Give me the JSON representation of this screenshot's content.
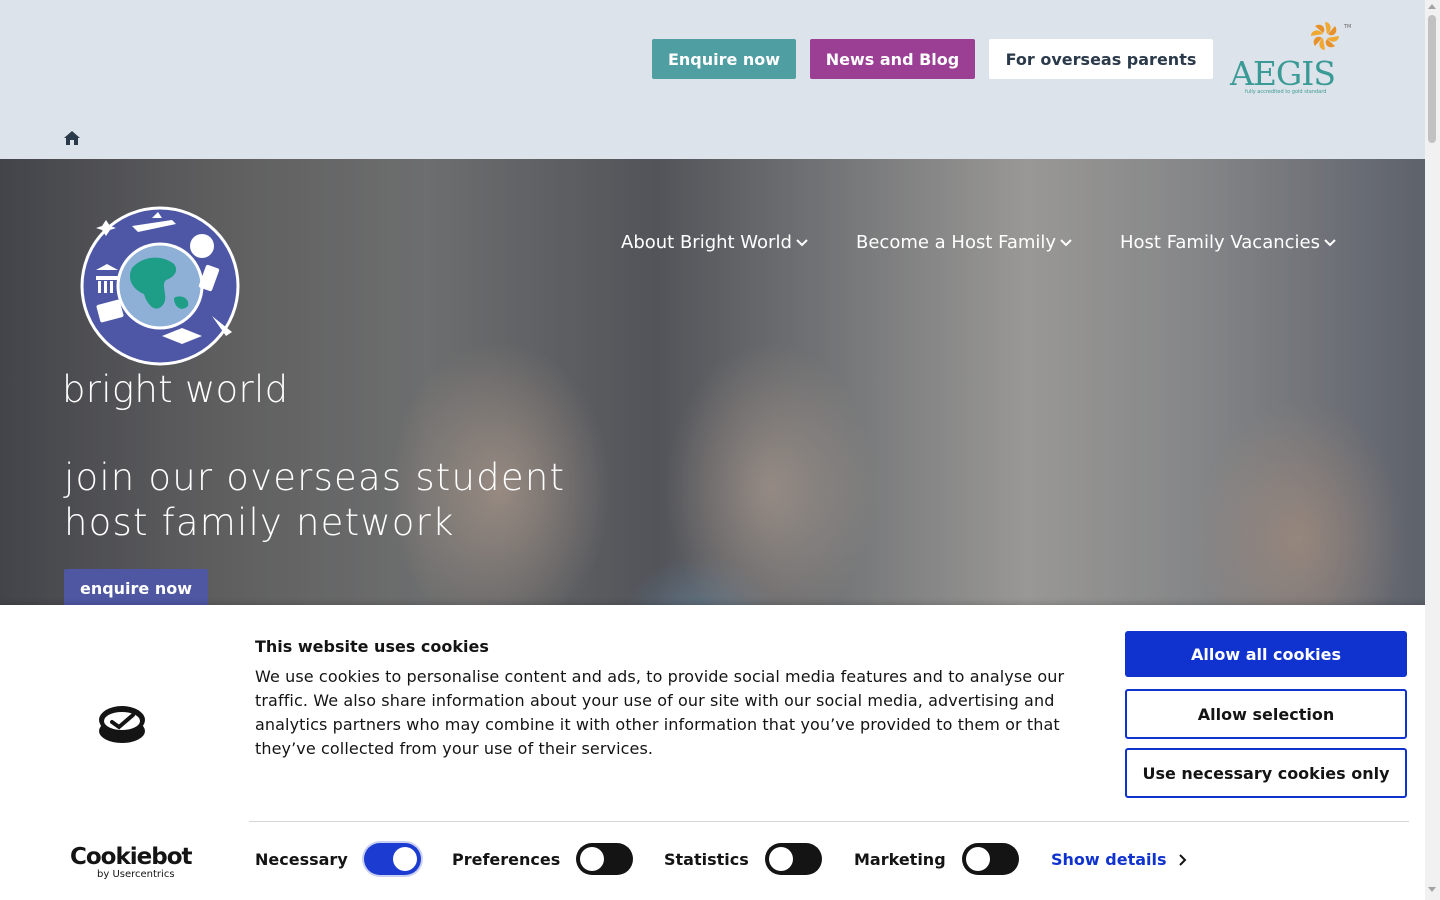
{
  "header": {
    "buttons": [
      {
        "label": "Enquire now"
      },
      {
        "label": "News and Blog"
      },
      {
        "label": "For overseas parents"
      }
    ],
    "accreditation_logo": {
      "name": "AEGIS",
      "tagline": "fully accredited to gold standard"
    },
    "home_icon": "home-icon"
  },
  "hero": {
    "logo_text": "bright world",
    "nav": [
      {
        "label": "About Bright World"
      },
      {
        "label": "Become a Host Family"
      },
      {
        "label": "Host Family Vacancies"
      }
    ],
    "headline_line1": "join our overseas student",
    "headline_line2": "host family network",
    "cta": "enquire now"
  },
  "cookie_banner": {
    "title": "This website uses cookies",
    "body": "We use cookies to personalise content and ads, to provide social media features and to analyse our traffic. We also share information about your use of our site with our social media, advertising and analytics partners who may combine it with other information that you’ve provided to them or that they’ve collected from your use of their services.",
    "buttons": {
      "allow_all": "Allow all cookies",
      "allow_selection": "Allow selection",
      "necessary_only": "Use necessary cookies only"
    },
    "toggles": [
      {
        "label": "Necessary",
        "on": true
      },
      {
        "label": "Preferences",
        "on": false
      },
      {
        "label": "Statistics",
        "on": false
      },
      {
        "label": "Marketing",
        "on": false
      }
    ],
    "show_details": "Show details",
    "brand": {
      "name": "Cookiebot",
      "sub": "by Usercentrics"
    }
  },
  "colors": {
    "header_bg": "#dde3ea",
    "enquire": "#4f9ea2",
    "news": "#9b3f95",
    "cta": "#4f57a3",
    "cookie_accent": "#1032cf"
  }
}
